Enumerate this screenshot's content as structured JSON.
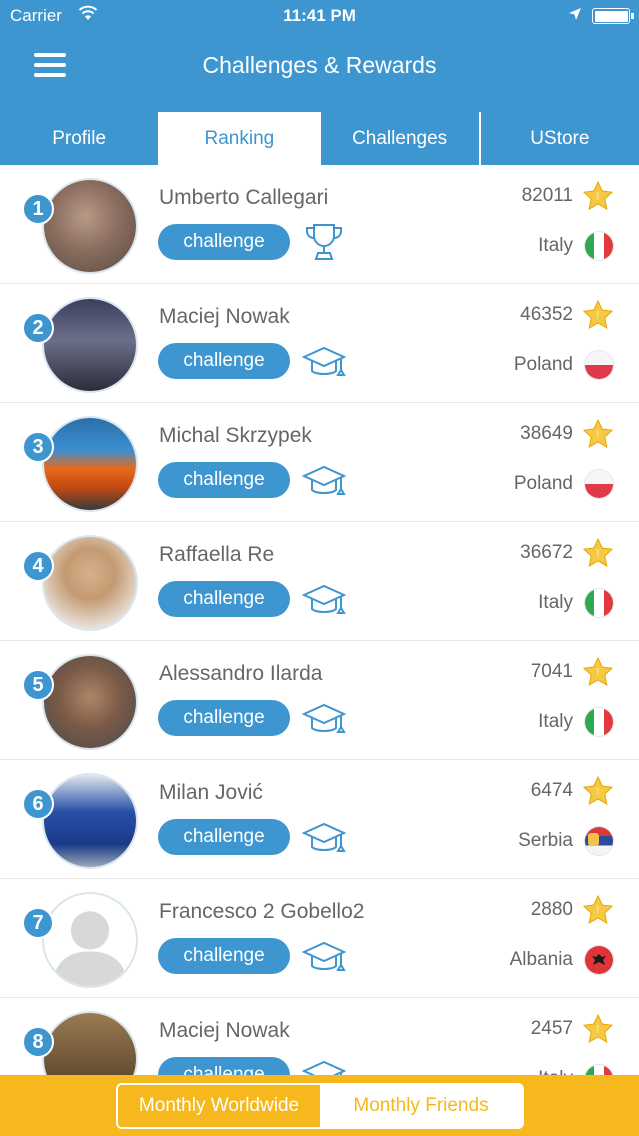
{
  "status": {
    "carrier": "Carrier",
    "time": "11:41 PM"
  },
  "nav": {
    "title": "Challenges & Rewards",
    "menu_icon": "hamburger-menu-icon"
  },
  "tabs": [
    {
      "label": "Profile",
      "active": false
    },
    {
      "label": "Ranking",
      "active": true
    },
    {
      "label": "Challenges",
      "active": false
    },
    {
      "label": "UStore",
      "active": false
    }
  ],
  "ranking": [
    {
      "rank": "1",
      "name": "Umberto Callegari",
      "button": "challenge",
      "badge": "trophy-icon",
      "score": "82011",
      "country": "Italy",
      "flag": "italy"
    },
    {
      "rank": "2",
      "name": "Maciej Nowak",
      "button": "challenge",
      "badge": "graduation-cap-icon",
      "score": "46352",
      "country": "Poland",
      "flag": "poland"
    },
    {
      "rank": "3",
      "name": "Michal Skrzypek",
      "button": "challenge",
      "badge": "graduation-cap-icon",
      "score": "38649",
      "country": "Poland",
      "flag": "poland"
    },
    {
      "rank": "4",
      "name": "Raffaella Re",
      "button": "challenge",
      "badge": "graduation-cap-icon",
      "score": "36672",
      "country": "Italy",
      "flag": "italy"
    },
    {
      "rank": "5",
      "name": "Alessandro Ilarda",
      "button": "challenge",
      "badge": "graduation-cap-icon",
      "score": "7041",
      "country": "Italy",
      "flag": "italy"
    },
    {
      "rank": "6",
      "name": "Milan Jović",
      "button": "challenge",
      "badge": "graduation-cap-icon",
      "score": "6474",
      "country": "Serbia",
      "flag": "serbia"
    },
    {
      "rank": "7",
      "name": "Francesco 2 Gobello2",
      "button": "challenge",
      "badge": "graduation-cap-icon",
      "score": "2880",
      "country": "Albania",
      "flag": "albania"
    },
    {
      "rank": "8",
      "name": "Maciej Nowak",
      "button": "challenge",
      "badge": "graduation-cap-icon",
      "score": "2457",
      "country": "Italy",
      "flag": "italy"
    }
  ],
  "bottom": {
    "worldwide": "Monthly Worldwide",
    "friends": "Monthly Friends"
  },
  "colors": {
    "primary": "#3d96cf",
    "accent": "#f6b81c"
  }
}
